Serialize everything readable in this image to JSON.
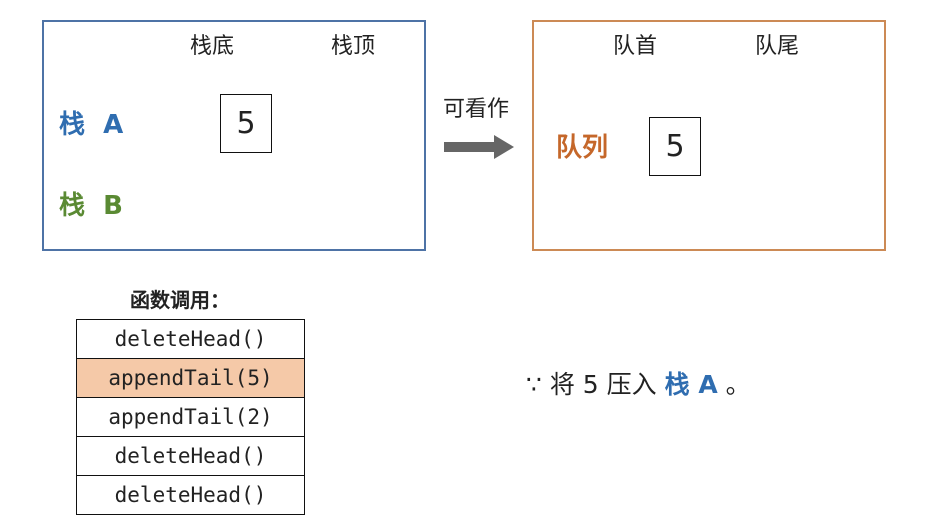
{
  "stack_panel": {
    "header_bottom": "栈底",
    "header_top": "栈顶",
    "stack_a_label": "栈  A",
    "stack_b_label": "栈  B",
    "stack_a_values": [
      "5"
    ],
    "border_color": "#4e73a6",
    "stack_a_color": "#2f6db0",
    "stack_b_color": "#5a8a33"
  },
  "arrow": {
    "label": "可看作",
    "color": "#666666"
  },
  "queue_panel": {
    "header_head": "队首",
    "header_tail": "队尾",
    "queue_label": "队列",
    "queue_values": [
      "5"
    ],
    "border_color": "#cc8a55",
    "label_color": "#c5672a"
  },
  "calls": {
    "title": "函数调用：",
    "items": [
      {
        "text": "deleteHead()",
        "active": false
      },
      {
        "text": "appendTail(5)",
        "active": true
      },
      {
        "text": "appendTail(2)",
        "active": false
      },
      {
        "text": "deleteHead()",
        "active": false
      },
      {
        "text": "deleteHead()",
        "active": false
      }
    ],
    "highlight_color": "#f5c9a8"
  },
  "caption": {
    "prefix": "∵ 将 5 压入 ",
    "emphasis": "栈 A",
    "suffix": " 。",
    "emphasis_color": "#2f6db0"
  }
}
